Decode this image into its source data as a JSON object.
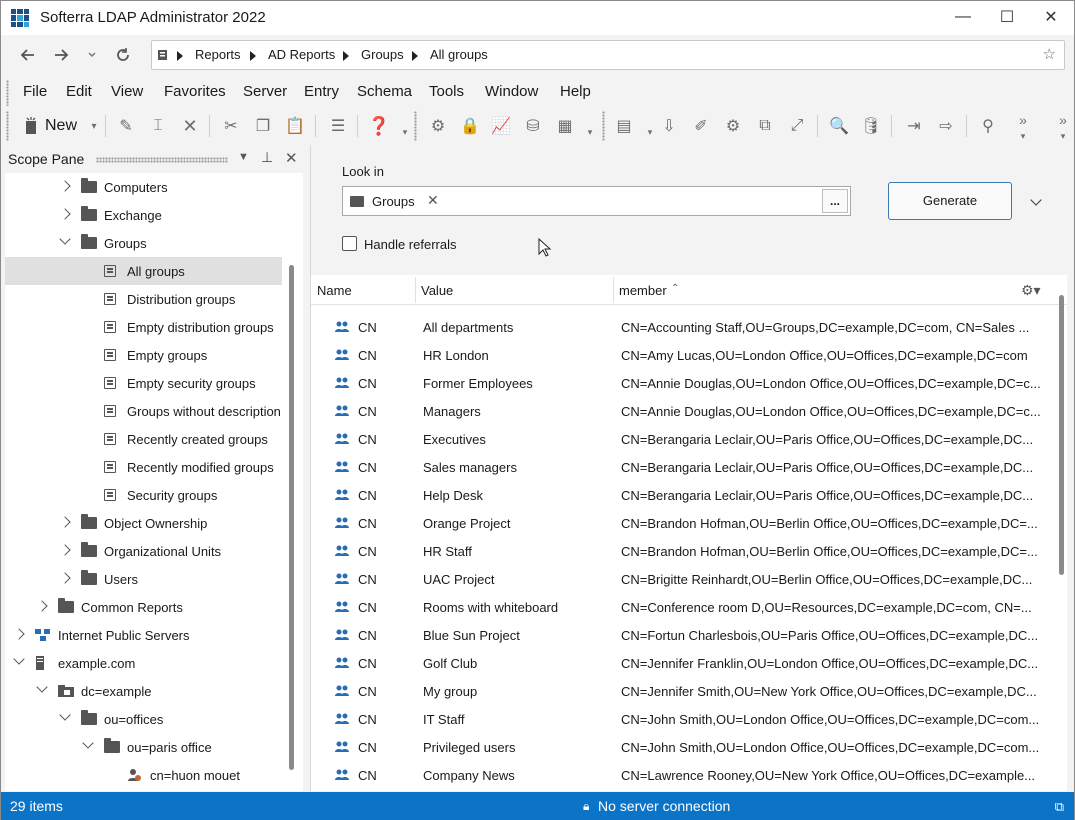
{
  "app": {
    "title": "Softerra LDAP Administrator 2022"
  },
  "window_controls": {
    "minimize": "—",
    "maximize": "☐",
    "close": "✕"
  },
  "nav": {
    "breadcrumb": [
      "Reports",
      "AD Reports",
      "Groups",
      "All groups"
    ]
  },
  "menu": [
    "File",
    "Edit",
    "View",
    "Favorites",
    "Server",
    "Entry",
    "Schema",
    "Tools",
    "Window",
    "Help"
  ],
  "toolbar": {
    "new_label": "New"
  },
  "scope_pane": {
    "title": "Scope Pane",
    "tree": [
      {
        "label": "Computers",
        "level": 2,
        "icon": "folder-icon",
        "expander": "right"
      },
      {
        "label": "Exchange",
        "level": 2,
        "icon": "folder-icon",
        "expander": "right"
      },
      {
        "label": "Groups",
        "level": 2,
        "icon": "folder-icon",
        "expander": "down"
      },
      {
        "label": "All groups",
        "level": 3,
        "icon": "report-icon",
        "expander": "",
        "selected": true
      },
      {
        "label": "Distribution groups",
        "level": 3,
        "icon": "report-icon",
        "expander": ""
      },
      {
        "label": "Empty distribution groups",
        "level": 3,
        "icon": "report-icon",
        "expander": ""
      },
      {
        "label": "Empty groups",
        "level": 3,
        "icon": "report-icon",
        "expander": ""
      },
      {
        "label": "Empty security groups",
        "level": 3,
        "icon": "report-icon",
        "expander": ""
      },
      {
        "label": "Groups without description",
        "level": 3,
        "icon": "report-icon",
        "expander": ""
      },
      {
        "label": "Recently created groups",
        "level": 3,
        "icon": "report-icon",
        "expander": ""
      },
      {
        "label": "Recently modified groups",
        "level": 3,
        "icon": "report-icon",
        "expander": ""
      },
      {
        "label": "Security groups",
        "level": 3,
        "icon": "report-icon",
        "expander": ""
      },
      {
        "label": "Object Ownership",
        "level": 2,
        "icon": "folder-icon",
        "expander": "right"
      },
      {
        "label": "Organizational Units",
        "level": 2,
        "icon": "folder-icon",
        "expander": "right"
      },
      {
        "label": "Users",
        "level": 2,
        "icon": "folder-icon",
        "expander": "right"
      },
      {
        "label": "Common Reports",
        "level": 1,
        "icon": "folder-icon",
        "expander": "right"
      },
      {
        "label": "Internet Public Servers",
        "level": 0,
        "icon": "network-icon",
        "expander": "right"
      },
      {
        "label": "example.com",
        "level": 0,
        "icon": "server-icon",
        "expander": "down"
      },
      {
        "label": "dc=example",
        "level": 1,
        "icon": "domain-icon",
        "expander": "down"
      },
      {
        "label": "ou=offices",
        "level": 2,
        "icon": "folder-icon",
        "expander": "down"
      },
      {
        "label": "ou=paris office",
        "level": 3,
        "icon": "folder-icon",
        "expander": "down"
      },
      {
        "label": "cn=huon mouet",
        "level": 4,
        "icon": "user-icon",
        "expander": ""
      }
    ]
  },
  "content": {
    "look_in_label": "Look in",
    "look_in_value": "Groups",
    "browse_label": "...",
    "generate_label": "Generate",
    "handle_referrals": "Handle referrals",
    "columns": [
      "Name",
      "Value",
      "member"
    ],
    "rows": [
      {
        "name": "CN",
        "value": "All departments",
        "member": "CN=Accounting Staff,OU=Groups,DC=example,DC=com, CN=Sales ..."
      },
      {
        "name": "CN",
        "value": "HR London",
        "member": "CN=Amy Lucas,OU=London Office,OU=Offices,DC=example,DC=com"
      },
      {
        "name": "CN",
        "value": "Former Employees",
        "member": "CN=Annie Douglas,OU=London Office,OU=Offices,DC=example,DC=c..."
      },
      {
        "name": "CN",
        "value": "Managers",
        "member": "CN=Annie Douglas,OU=London Office,OU=Offices,DC=example,DC=c..."
      },
      {
        "name": "CN",
        "value": "Executives",
        "member": "CN=Berangaria Leclair,OU=Paris Office,OU=Offices,DC=example,DC..."
      },
      {
        "name": "CN",
        "value": "Sales managers",
        "member": "CN=Berangaria Leclair,OU=Paris Office,OU=Offices,DC=example,DC..."
      },
      {
        "name": "CN",
        "value": "Help Desk",
        "member": "CN=Berangaria Leclair,OU=Paris Office,OU=Offices,DC=example,DC..."
      },
      {
        "name": "CN",
        "value": "Orange Project",
        "member": "CN=Brandon Hofman,OU=Berlin Office,OU=Offices,DC=example,DC=..."
      },
      {
        "name": "CN",
        "value": "HR Staff",
        "member": "CN=Brandon Hofman,OU=Berlin Office,OU=Offices,DC=example,DC=..."
      },
      {
        "name": "CN",
        "value": "UAC Project",
        "member": "CN=Brigitte Reinhardt,OU=Berlin Office,OU=Offices,DC=example,DC..."
      },
      {
        "name": "CN",
        "value": "Rooms with whiteboard",
        "member": "CN=Conference room D,OU=Resources,DC=example,DC=com, CN=..."
      },
      {
        "name": "CN",
        "value": "Blue Sun Project",
        "member": "CN=Fortun Charlesbois,OU=Paris Office,OU=Offices,DC=example,DC..."
      },
      {
        "name": "CN",
        "value": "Golf Club",
        "member": "CN=Jennifer Franklin,OU=London Office,OU=Offices,DC=example,DC..."
      },
      {
        "name": "CN",
        "value": "My group",
        "member": "CN=Jennifer Smith,OU=New York Office,OU=Offices,DC=example,DC..."
      },
      {
        "name": "CN",
        "value": "IT Staff",
        "member": "CN=John Smith,OU=London Office,OU=Offices,DC=example,DC=com..."
      },
      {
        "name": "CN",
        "value": "Privileged users",
        "member": "CN=John Smith,OU=London Office,OU=Offices,DC=example,DC=com..."
      },
      {
        "name": "CN",
        "value": "Company News",
        "member": "CN=Lawrence Rooney,OU=New York Office,OU=Offices,DC=example..."
      }
    ]
  },
  "status": {
    "count": "29 items",
    "connection": "No server connection"
  },
  "colors": {
    "accent": "#0c74c7",
    "generate_border": "#3c77b8",
    "group_icon": "#2a6cb8"
  }
}
